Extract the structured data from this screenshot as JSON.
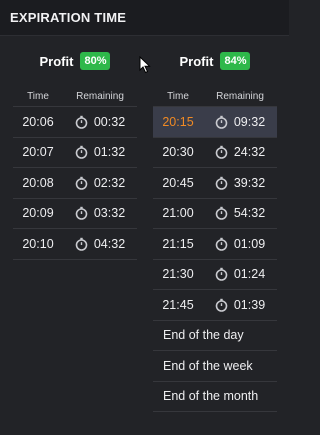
{
  "header": {
    "title": "EXPIRATION TIME"
  },
  "left": {
    "profit_label": "Profit",
    "profit_value": "80%",
    "col_time": "Time",
    "col_remaining": "Remaining",
    "rows": [
      {
        "time": "20:06",
        "remaining": "00:32"
      },
      {
        "time": "20:07",
        "remaining": "01:32"
      },
      {
        "time": "20:08",
        "remaining": "02:32"
      },
      {
        "time": "20:09",
        "remaining": "03:32"
      },
      {
        "time": "20:10",
        "remaining": "04:32"
      }
    ]
  },
  "right": {
    "profit_label": "Profit",
    "profit_value": "84%",
    "col_time": "Time",
    "col_remaining": "Remaining",
    "rows": [
      {
        "time": "20:15",
        "remaining": "09:32"
      },
      {
        "time": "20:30",
        "remaining": "24:32"
      },
      {
        "time": "20:45",
        "remaining": "39:32"
      },
      {
        "time": "21:00",
        "remaining": "54:32"
      },
      {
        "time": "21:15",
        "remaining": "01:09"
      },
      {
        "time": "21:30",
        "remaining": "01:24"
      },
      {
        "time": "21:45",
        "remaining": "01:39"
      }
    ],
    "periods": [
      "End of the day",
      "End of the week",
      "End of the month"
    ]
  },
  "icons": {
    "clock": "stopwatch-icon",
    "cursor": "mouse-cursor"
  },
  "colors": {
    "accent": "#2eb84a",
    "selected_time": "#f08a24",
    "selected_bg": "#3a3d4a"
  }
}
